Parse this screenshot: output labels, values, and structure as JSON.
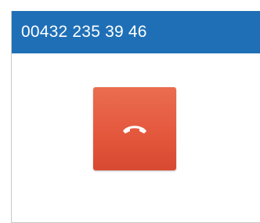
{
  "call": {
    "phone_number": "00432 235 39 46"
  },
  "hangup_button": {
    "icon": "phone-hangup-icon"
  },
  "colors": {
    "header_background": "#1f6fb7",
    "header_text": "#ffffff",
    "hangup_button": "#e4583e",
    "icon": "#ffffff"
  }
}
